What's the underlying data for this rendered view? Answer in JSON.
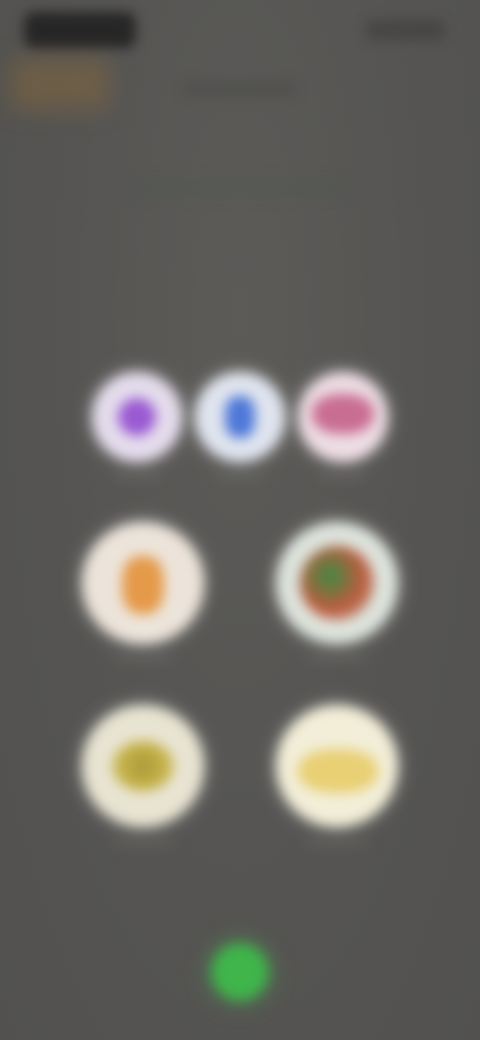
{
  "status_bar": {
    "time_icon": "time-block",
    "right_icons": "status-icons"
  },
  "header": {
    "title": "",
    "subtitle": ""
  },
  "buttons": [
    {
      "icon": "purple-circle-icon",
      "color": "#9a5ad2"
    },
    {
      "icon": "blue-circle-icon",
      "color": "#4e78d8"
    },
    {
      "icon": "pink-circle-icon",
      "color": "#c25a84"
    },
    {
      "icon": "orange-food-icon",
      "color": "#e59a4a"
    },
    {
      "icon": "salad-icon",
      "color": "#3e8a42"
    },
    {
      "icon": "yellow-food-icon",
      "color": "#c8b44a"
    },
    {
      "icon": "pastry-icon",
      "color": "#e8cc6a"
    }
  ],
  "call": {
    "icon": "phone-icon",
    "color": "#3fb54a"
  },
  "colors": {
    "background": "#555452",
    "accent_green": "#3fb54a"
  }
}
